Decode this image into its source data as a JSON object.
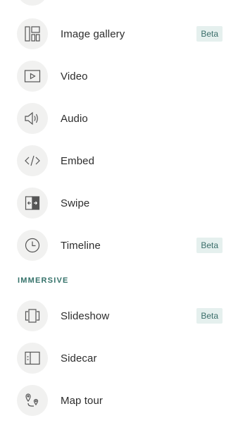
{
  "items_top": [
    {
      "label": "Image gallery",
      "icon": "image-gallery-icon",
      "badge": "Beta"
    },
    {
      "label": "Video",
      "icon": "video-icon",
      "badge": ""
    },
    {
      "label": "Audio",
      "icon": "audio-icon",
      "badge": ""
    },
    {
      "label": "Embed",
      "icon": "embed-icon",
      "badge": ""
    },
    {
      "label": "Swipe",
      "icon": "swipe-icon",
      "badge": ""
    },
    {
      "label": "Timeline",
      "icon": "timeline-icon",
      "badge": "Beta"
    }
  ],
  "section": {
    "title": "IMMERSIVE"
  },
  "items_immersive": [
    {
      "label": "Slideshow",
      "icon": "slideshow-icon",
      "badge": "Beta"
    },
    {
      "label": "Sidecar",
      "icon": "sidecar-icon",
      "badge": ""
    },
    {
      "label": "Map tour",
      "icon": "map-tour-icon",
      "badge": ""
    }
  ],
  "colors": {
    "accent": "#35726a",
    "badge_bg": "#e5f0ee",
    "icon_bg": "#f1f1f0"
  }
}
